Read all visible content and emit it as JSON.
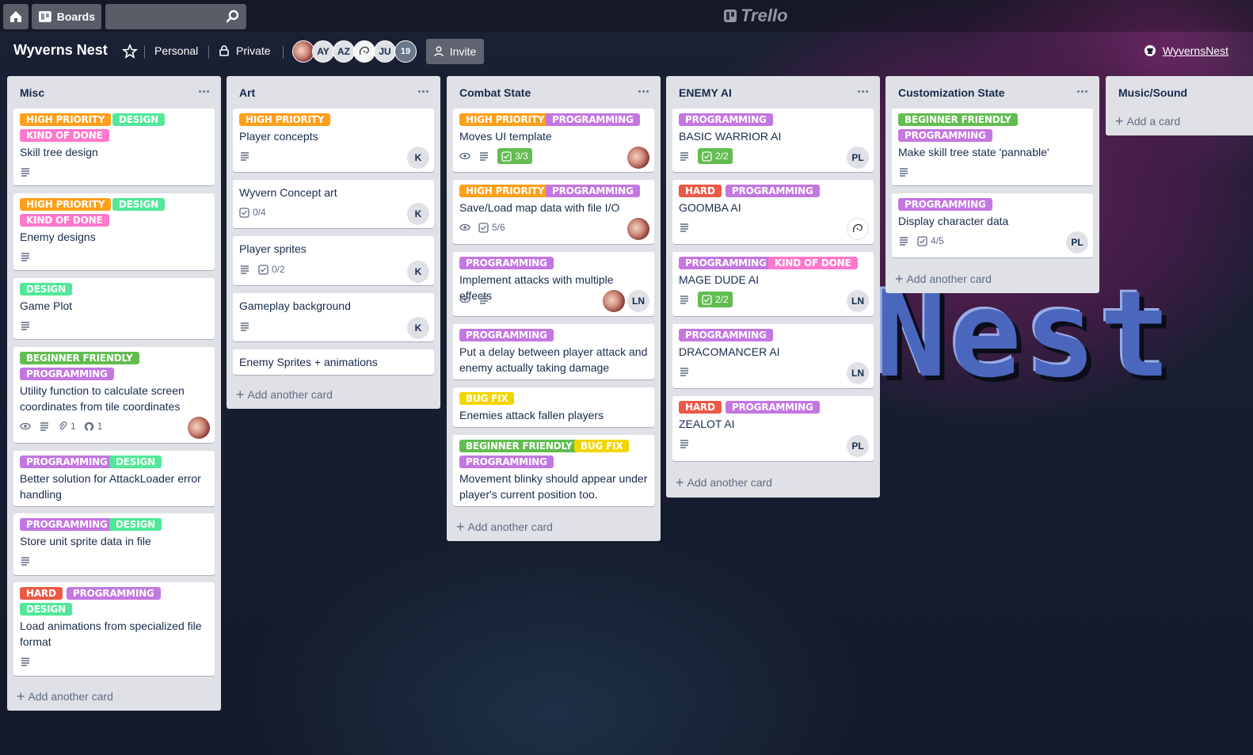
{
  "header": {
    "boards_label": "Boards",
    "search_value": "",
    "logo_text": "Trello"
  },
  "board": {
    "title": "Wyverns Nest",
    "team": "Personal",
    "visibility": "Private",
    "members": [
      "AY",
      "AZ",
      "JU"
    ],
    "member_count": "19",
    "invite_label": "Invite",
    "github_label": "WyvernsNest",
    "background_text": "Nest"
  },
  "colors": {
    "orange": "#ff9f1a",
    "green": "#51e898",
    "pink": "#ff78cb",
    "purple": "#c377e0",
    "dark_green": "#61bd4f",
    "red": "#eb5a46",
    "yellow": "#f2d600"
  },
  "lists": [
    {
      "title": "Misc",
      "add_label": "Add another card",
      "cards": [
        {
          "labels": [
            "HIGH PRIORITY",
            "DESIGN",
            "KIND OF DONE"
          ],
          "title": "Skill tree design"
        },
        {
          "labels": [
            "HIGH PRIORITY",
            "DESIGN",
            "KIND OF DONE"
          ],
          "title": "Enemy designs"
        },
        {
          "labels": [
            "DESIGN"
          ],
          "title": "Game Plot"
        },
        {
          "labels": [
            "BEGINNER FRIENDLY",
            "PROGRAMMING"
          ],
          "title": "Utility function to calculate screen coordinates from tile coordinates",
          "attachments": "1",
          "github": "1"
        },
        {
          "labels": [
            "PROGRAMMING",
            "DESIGN"
          ],
          "title": "Better solution for AttackLoader error handling"
        },
        {
          "labels": [
            "PROGRAMMING",
            "DESIGN"
          ],
          "title": "Store unit sprite data in file"
        },
        {
          "labels": [
            "HARD",
            "PROGRAMMING",
            "DESIGN"
          ],
          "title": "Load animations from specialized file format"
        }
      ]
    },
    {
      "title": "Art",
      "add_label": "Add another card",
      "cards": [
        {
          "labels": [
            "HIGH PRIORITY"
          ],
          "title": "Player concepts",
          "member": "K"
        },
        {
          "labels": [],
          "title": "Wyvern Concept art",
          "checklist": "0/4",
          "member": "K"
        },
        {
          "labels": [],
          "title": "Player sprites",
          "checklist": "0/2",
          "member": "K"
        },
        {
          "labels": [],
          "title": "Gameplay background",
          "member": "K"
        },
        {
          "labels": [],
          "title": "Enemy Sprites + animations"
        }
      ]
    },
    {
      "title": "Combat State",
      "add_label": "Add another card",
      "cards": [
        {
          "labels": [
            "HIGH PRIORITY",
            "PROGRAMMING"
          ],
          "title": "Moves UI template",
          "checklist": "3/3"
        },
        {
          "labels": [
            "HIGH PRIORITY",
            "PROGRAMMING"
          ],
          "title": "Save/Load map data with file I/O",
          "checklist": "5/6"
        },
        {
          "labels": [
            "PROGRAMMING"
          ],
          "title": "Implement attacks with multiple effects",
          "member": "LN"
        },
        {
          "labels": [
            "PROGRAMMING"
          ],
          "title": "Put a delay between player attack and enemy actually taking damage"
        },
        {
          "labels": [
            "BUG FIX"
          ],
          "title": "Enemies attack fallen players"
        },
        {
          "labels": [
            "BEGINNER FRIENDLY",
            "BUG FIX",
            "PROGRAMMING"
          ],
          "title": "Movement blinky should appear under player's current position too."
        }
      ]
    },
    {
      "title": "ENEMY AI",
      "add_label": "Add another card",
      "cards": [
        {
          "labels": [
            "PROGRAMMING"
          ],
          "title": "BASIC WARRIOR AI",
          "checklist": "2/2",
          "member": "PL"
        },
        {
          "labels": [
            "HARD",
            "PROGRAMMING"
          ],
          "title": "GOOMBA AI"
        },
        {
          "labels": [
            "PROGRAMMING",
            "KIND OF DONE"
          ],
          "title": "MAGE DUDE AI",
          "checklist": "2/2",
          "member": "LN"
        },
        {
          "labels": [
            "PROGRAMMING"
          ],
          "title": "DRACOMANCER AI",
          "member": "LN"
        },
        {
          "labels": [
            "HARD",
            "PROGRAMMING"
          ],
          "title": "ZEALOT AI",
          "member": "PL"
        }
      ]
    },
    {
      "title": "Customization State",
      "add_label": "Add another card",
      "cards": [
        {
          "labels": [
            "BEGINNER FRIENDLY",
            "PROGRAMMING"
          ],
          "title": "Make skill tree state 'pannable'"
        },
        {
          "labels": [
            "PROGRAMMING"
          ],
          "title": "Display character data",
          "checklist": "4/5",
          "member": "PL"
        }
      ]
    },
    {
      "title": "Music/Sound",
      "add_label": "Add a card",
      "cards": []
    }
  ]
}
